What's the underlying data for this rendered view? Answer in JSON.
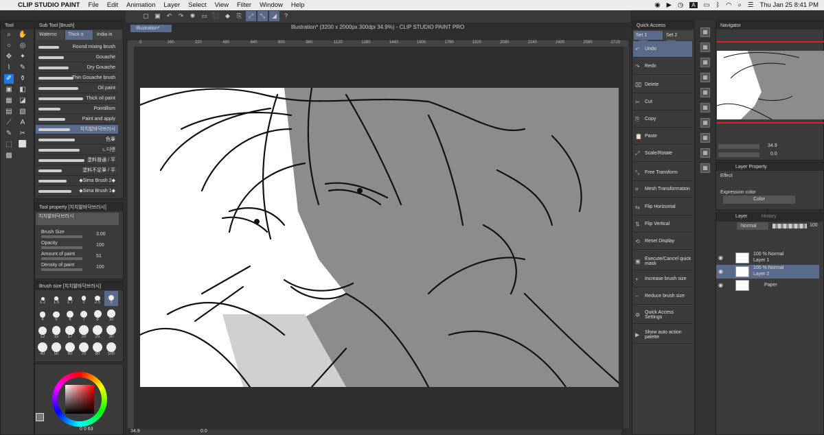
{
  "menubar": {
    "app": "CLIP STUDIO PAINT",
    "items": [
      "File",
      "Edit",
      "Animation",
      "Layer",
      "Select",
      "View",
      "Filter",
      "Window",
      "Help"
    ],
    "clock": "Thu Jan 25  8:41 PM",
    "a_icon": "A"
  },
  "title": {
    "doc": "Illustration* (3200 x 2000px 300dpi 34.9%) - CLIP STUDIO PAINT PRO",
    "tab": "Illustration*"
  },
  "tool_panel": {
    "title": "Tool"
  },
  "subtool": {
    "title": "Sub Tool [Brush]",
    "tabs": [
      "Waterco",
      "Thick o",
      "India in"
    ],
    "brushes": [
      "Round mixing brush",
      "Gouache",
      "Dry Gouache",
      "Thin Gouache brush",
      "Oil paint",
      "Thick oil paint",
      "Pointillism",
      "Paint and apply",
      "치치발바닥브러시",
      "色筆",
      "ㄴ디랜",
      "塗料普通 / 平",
      "塗料不足筆 / 平",
      "◆Sima Brush 2◆",
      "◆Sima Brush 1◆"
    ],
    "selected_index": 8
  },
  "tool_property": {
    "title": "Tool property [치치발바닥브러시]",
    "brush_name": "치치발바닥브러시",
    "rows": [
      {
        "label": "Brush Size",
        "value": "3.00"
      },
      {
        "label": "Opacity",
        "value": "100"
      },
      {
        "label": "Amount of paint",
        "value": "51"
      },
      {
        "label": "Density of paint",
        "value": "100"
      }
    ]
  },
  "brush_size": {
    "title": "Brush size [치치발바닥브러시]",
    "sizes": [
      "1.2",
      "1.5",
      "1.7",
      "2",
      "2.5",
      "3",
      "4",
      "5",
      "6",
      "7",
      "8",
      "10",
      "12",
      "15",
      "17",
      "20",
      "25",
      "30",
      "40",
      "50",
      "60",
      "70",
      "80",
      "100"
    ],
    "selected": "3"
  },
  "color": {
    "readout": "0  0  63"
  },
  "ruler": [
    "0",
    "160",
    "320",
    "480",
    "640",
    "800",
    "960",
    "1120",
    "1280",
    "1440",
    "1600",
    "1760",
    "1920",
    "2080",
    "2240",
    "2400",
    "2560",
    "2720",
    "2880",
    "3040"
  ],
  "status": {
    "zoom": "34.9",
    "angle": "0.0"
  },
  "quick_access": {
    "title": "Quick Access",
    "sets": [
      "Set 1",
      "Set 2"
    ],
    "items": [
      "Undo",
      "Redo",
      "Delete",
      "Cut",
      "Copy",
      "Paste",
      "Scale/Rotate",
      "Free Transform",
      "Mesh Transformation",
      "Flip Horizontal",
      "Flip Vertical",
      "Reset Display",
      "Execute/Cancel quick mask",
      "Increase brush size",
      "Reduce brush size",
      "Quick Access Settings",
      "Show auto action palette"
    ]
  },
  "navigator": {
    "title": "Navigator",
    "zoom": "34.9",
    "angle": "0.0"
  },
  "layer_property": {
    "title": "Layer Property",
    "effect": "Effect",
    "expression_color_label": "Expression color",
    "expression_color": "Color"
  },
  "layer": {
    "tabs": [
      "Layer",
      "History"
    ],
    "blend": "Normal",
    "opacity": "100",
    "layers": [
      {
        "mode": "100 % Normal",
        "name": "Layer 1"
      },
      {
        "mode": "100 % Normal",
        "name": "Layer 2",
        "selected": true
      },
      {
        "mode": "",
        "name": "Paper"
      }
    ]
  },
  "colors": {
    "accent": "#5a6a8a",
    "highlight": "#1e7be6"
  }
}
